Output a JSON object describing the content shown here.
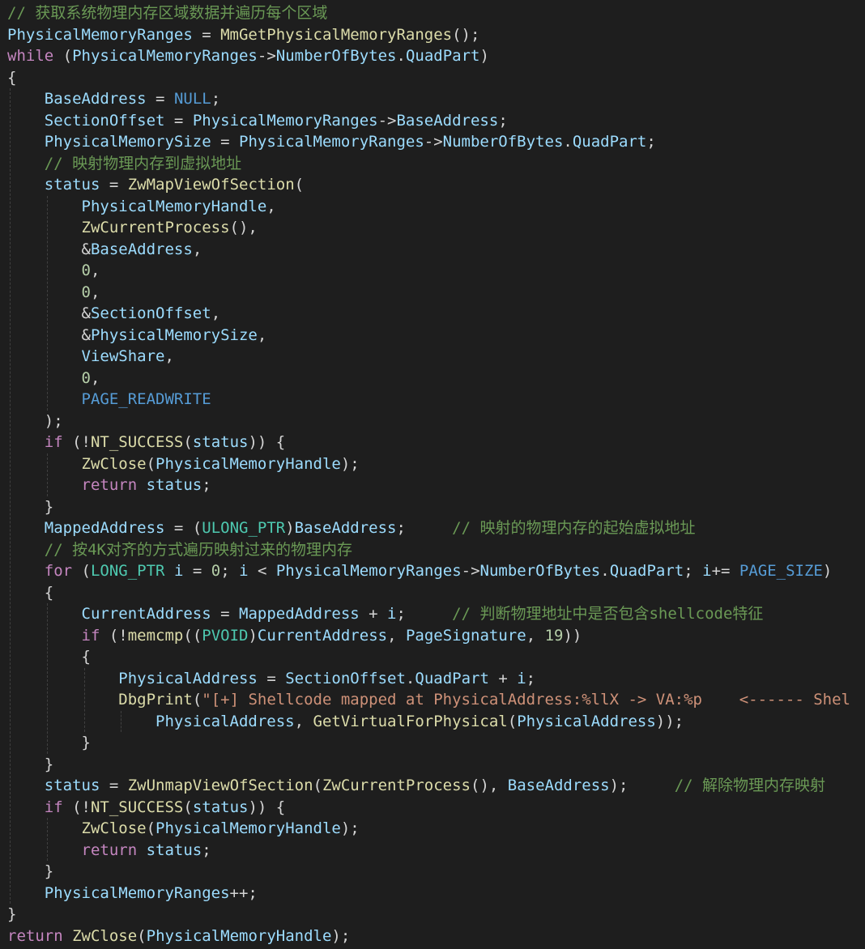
{
  "editor": {
    "theme": {
      "background": "#1e1e1e",
      "comment": "#6a9955",
      "variable": "#9cdcfe",
      "function": "#dcdcaa",
      "control_keyword": "#c586c0",
      "keyword": "#569cd6",
      "type": "#4ec9b0",
      "number": "#b5cea8",
      "string": "#ce9178",
      "punctuation": "#d4d4d4"
    },
    "lines": [
      {
        "indent": 0,
        "tokens": [
          {
            "t": "// 获取系统物理内存区域数据并遍历每个区域",
            "c": "c"
          }
        ]
      },
      {
        "indent": 0,
        "tokens": [
          {
            "t": "PhysicalMemoryRanges",
            "c": "v"
          },
          {
            "t": " = ",
            "c": "p"
          },
          {
            "t": "MmGetPhysicalMemoryRanges",
            "c": "f"
          },
          {
            "t": "();",
            "c": "p"
          }
        ]
      },
      {
        "indent": 0,
        "tokens": [
          {
            "t": "while",
            "c": "k"
          },
          {
            "t": " (",
            "c": "p"
          },
          {
            "t": "PhysicalMemoryRanges",
            "c": "v"
          },
          {
            "t": "->",
            "c": "p"
          },
          {
            "t": "NumberOfBytes",
            "c": "v"
          },
          {
            "t": ".",
            "c": "p"
          },
          {
            "t": "QuadPart",
            "c": "v"
          },
          {
            "t": ")",
            "c": "p"
          }
        ]
      },
      {
        "indent": 0,
        "tokens": [
          {
            "t": "{",
            "c": "p"
          }
        ]
      },
      {
        "indent": 1,
        "tokens": [
          {
            "t": "BaseAddress",
            "c": "v"
          },
          {
            "t": " = ",
            "c": "p"
          },
          {
            "t": "NULL",
            "c": "kb"
          },
          {
            "t": ";",
            "c": "p"
          }
        ]
      },
      {
        "indent": 1,
        "tokens": [
          {
            "t": "SectionOffset",
            "c": "v"
          },
          {
            "t": " = ",
            "c": "p"
          },
          {
            "t": "PhysicalMemoryRanges",
            "c": "v"
          },
          {
            "t": "->",
            "c": "p"
          },
          {
            "t": "BaseAddress",
            "c": "v"
          },
          {
            "t": ";",
            "c": "p"
          }
        ]
      },
      {
        "indent": 1,
        "tokens": [
          {
            "t": "PhysicalMemorySize",
            "c": "v"
          },
          {
            "t": " = ",
            "c": "p"
          },
          {
            "t": "PhysicalMemoryRanges",
            "c": "v"
          },
          {
            "t": "->",
            "c": "p"
          },
          {
            "t": "NumberOfBytes",
            "c": "v"
          },
          {
            "t": ".",
            "c": "p"
          },
          {
            "t": "QuadPart",
            "c": "v"
          },
          {
            "t": ";",
            "c": "p"
          }
        ]
      },
      {
        "indent": 1,
        "tokens": [
          {
            "t": "// 映射物理内存到虚拟地址",
            "c": "c"
          }
        ]
      },
      {
        "indent": 1,
        "tokens": [
          {
            "t": "status",
            "c": "v"
          },
          {
            "t": " = ",
            "c": "p"
          },
          {
            "t": "ZwMapViewOfSection",
            "c": "f"
          },
          {
            "t": "(",
            "c": "p"
          }
        ]
      },
      {
        "indent": 2,
        "tokens": [
          {
            "t": "PhysicalMemoryHandle",
            "c": "v"
          },
          {
            "t": ",",
            "c": "p"
          }
        ]
      },
      {
        "indent": 2,
        "tokens": [
          {
            "t": "ZwCurrentProcess",
            "c": "f"
          },
          {
            "t": "(),",
            "c": "p"
          }
        ]
      },
      {
        "indent": 2,
        "tokens": [
          {
            "t": "&",
            "c": "p"
          },
          {
            "t": "BaseAddress",
            "c": "v"
          },
          {
            "t": ",",
            "c": "p"
          }
        ]
      },
      {
        "indent": 2,
        "tokens": [
          {
            "t": "0",
            "c": "n"
          },
          {
            "t": ",",
            "c": "p"
          }
        ]
      },
      {
        "indent": 2,
        "tokens": [
          {
            "t": "0",
            "c": "n"
          },
          {
            "t": ",",
            "c": "p"
          }
        ]
      },
      {
        "indent": 2,
        "tokens": [
          {
            "t": "&",
            "c": "p"
          },
          {
            "t": "SectionOffset",
            "c": "v"
          },
          {
            "t": ",",
            "c": "p"
          }
        ]
      },
      {
        "indent": 2,
        "tokens": [
          {
            "t": "&",
            "c": "p"
          },
          {
            "t": "PhysicalMemorySize",
            "c": "v"
          },
          {
            "t": ",",
            "c": "p"
          }
        ]
      },
      {
        "indent": 2,
        "tokens": [
          {
            "t": "ViewShare",
            "c": "v"
          },
          {
            "t": ",",
            "c": "p"
          }
        ]
      },
      {
        "indent": 2,
        "tokens": [
          {
            "t": "0",
            "c": "n"
          },
          {
            "t": ",",
            "c": "p"
          }
        ]
      },
      {
        "indent": 2,
        "tokens": [
          {
            "t": "PAGE_READWRITE",
            "c": "kb"
          }
        ]
      },
      {
        "indent": 1,
        "tokens": [
          {
            "t": ");",
            "c": "p"
          }
        ]
      },
      {
        "indent": 1,
        "tokens": [
          {
            "t": "if",
            "c": "k"
          },
          {
            "t": " (!",
            "c": "p"
          },
          {
            "t": "NT_SUCCESS",
            "c": "f"
          },
          {
            "t": "(",
            "c": "p"
          },
          {
            "t": "status",
            "c": "v"
          },
          {
            "t": ")) {",
            "c": "p"
          }
        ]
      },
      {
        "indent": 2,
        "tokens": [
          {
            "t": "ZwClose",
            "c": "f"
          },
          {
            "t": "(",
            "c": "p"
          },
          {
            "t": "PhysicalMemoryHandle",
            "c": "v"
          },
          {
            "t": ");",
            "c": "p"
          }
        ]
      },
      {
        "indent": 2,
        "tokens": [
          {
            "t": "return",
            "c": "k"
          },
          {
            "t": " ",
            "c": "p"
          },
          {
            "t": "status",
            "c": "v"
          },
          {
            "t": ";",
            "c": "p"
          }
        ]
      },
      {
        "indent": 1,
        "tokens": [
          {
            "t": "}",
            "c": "p"
          }
        ]
      },
      {
        "indent": 1,
        "tokens": [
          {
            "t": "MappedAddress",
            "c": "v"
          },
          {
            "t": " = (",
            "c": "p"
          },
          {
            "t": "ULONG_PTR",
            "c": "t"
          },
          {
            "t": ")",
            "c": "p"
          },
          {
            "t": "BaseAddress",
            "c": "v"
          },
          {
            "t": ";     ",
            "c": "p"
          },
          {
            "t": "// 映射的物理内存的起始虚拟地址",
            "c": "c"
          }
        ]
      },
      {
        "indent": 1,
        "tokens": [
          {
            "t": "// 按4K对齐的方式遍历映射过来的物理内存",
            "c": "c"
          }
        ]
      },
      {
        "indent": 1,
        "tokens": [
          {
            "t": "for",
            "c": "k"
          },
          {
            "t": " (",
            "c": "p"
          },
          {
            "t": "LONG_PTR",
            "c": "t"
          },
          {
            "t": " ",
            "c": "p"
          },
          {
            "t": "i",
            "c": "v"
          },
          {
            "t": " = ",
            "c": "p"
          },
          {
            "t": "0",
            "c": "n"
          },
          {
            "t": "; ",
            "c": "p"
          },
          {
            "t": "i",
            "c": "v"
          },
          {
            "t": " < ",
            "c": "p"
          },
          {
            "t": "PhysicalMemoryRanges",
            "c": "v"
          },
          {
            "t": "->",
            "c": "p"
          },
          {
            "t": "NumberOfBytes",
            "c": "v"
          },
          {
            "t": ".",
            "c": "p"
          },
          {
            "t": "QuadPart",
            "c": "v"
          },
          {
            "t": "; ",
            "c": "p"
          },
          {
            "t": "i",
            "c": "v"
          },
          {
            "t": "+= ",
            "c": "p"
          },
          {
            "t": "PAGE_SIZE",
            "c": "kb"
          },
          {
            "t": ")",
            "c": "p"
          }
        ]
      },
      {
        "indent": 1,
        "tokens": [
          {
            "t": "{",
            "c": "p"
          }
        ]
      },
      {
        "indent": 2,
        "tokens": [
          {
            "t": "CurrentAddress",
            "c": "v"
          },
          {
            "t": " = ",
            "c": "p"
          },
          {
            "t": "MappedAddress",
            "c": "v"
          },
          {
            "t": " + ",
            "c": "p"
          },
          {
            "t": "i",
            "c": "v"
          },
          {
            "t": ";     ",
            "c": "p"
          },
          {
            "t": "// 判断物理地址中是否包含shellcode特征",
            "c": "c"
          }
        ]
      },
      {
        "indent": 2,
        "tokens": [
          {
            "t": "if",
            "c": "k"
          },
          {
            "t": " (!",
            "c": "p"
          },
          {
            "t": "memcmp",
            "c": "f"
          },
          {
            "t": "((",
            "c": "p"
          },
          {
            "t": "PVOID",
            "c": "t"
          },
          {
            "t": ")",
            "c": "p"
          },
          {
            "t": "CurrentAddress",
            "c": "v"
          },
          {
            "t": ", ",
            "c": "p"
          },
          {
            "t": "PageSignature",
            "c": "v"
          },
          {
            "t": ", ",
            "c": "p"
          },
          {
            "t": "19",
            "c": "n"
          },
          {
            "t": "))",
            "c": "p"
          }
        ]
      },
      {
        "indent": 2,
        "tokens": [
          {
            "t": "{",
            "c": "p"
          }
        ]
      },
      {
        "indent": 3,
        "tokens": [
          {
            "t": "PhysicalAddress",
            "c": "v"
          },
          {
            "t": " = ",
            "c": "p"
          },
          {
            "t": "SectionOffset",
            "c": "v"
          },
          {
            "t": ".",
            "c": "p"
          },
          {
            "t": "QuadPart",
            "c": "v"
          },
          {
            "t": " + ",
            "c": "p"
          },
          {
            "t": "i",
            "c": "v"
          },
          {
            "t": ";",
            "c": "p"
          }
        ]
      },
      {
        "indent": 3,
        "tokens": [
          {
            "t": "DbgPrint",
            "c": "f"
          },
          {
            "t": "(",
            "c": "p"
          },
          {
            "t": "\"[+] Shellcode mapped at PhysicalAddress:%llX -> VA:%p    <------ Shel",
            "c": "s"
          }
        ]
      },
      {
        "indent": 4,
        "tokens": [
          {
            "t": "PhysicalAddress",
            "c": "v"
          },
          {
            "t": ", ",
            "c": "p"
          },
          {
            "t": "GetVirtualForPhysical",
            "c": "f"
          },
          {
            "t": "(",
            "c": "p"
          },
          {
            "t": "PhysicalAddress",
            "c": "v"
          },
          {
            "t": "));",
            "c": "p"
          }
        ]
      },
      {
        "indent": 2,
        "tokens": [
          {
            "t": "}",
            "c": "p"
          }
        ]
      },
      {
        "indent": 1,
        "tokens": [
          {
            "t": "}",
            "c": "p"
          }
        ]
      },
      {
        "indent": 1,
        "tokens": [
          {
            "t": "status",
            "c": "v"
          },
          {
            "t": " = ",
            "c": "p"
          },
          {
            "t": "ZwUnmapViewOfSection",
            "c": "f"
          },
          {
            "t": "(",
            "c": "p"
          },
          {
            "t": "ZwCurrentProcess",
            "c": "f"
          },
          {
            "t": "(), ",
            "c": "p"
          },
          {
            "t": "BaseAddress",
            "c": "v"
          },
          {
            "t": ");     ",
            "c": "p"
          },
          {
            "t": "// 解除物理内存映射",
            "c": "c"
          }
        ]
      },
      {
        "indent": 1,
        "tokens": [
          {
            "t": "if",
            "c": "k"
          },
          {
            "t": " (!",
            "c": "p"
          },
          {
            "t": "NT_SUCCESS",
            "c": "f"
          },
          {
            "t": "(",
            "c": "p"
          },
          {
            "t": "status",
            "c": "v"
          },
          {
            "t": ")) {",
            "c": "p"
          }
        ]
      },
      {
        "indent": 2,
        "tokens": [
          {
            "t": "ZwClose",
            "c": "f"
          },
          {
            "t": "(",
            "c": "p"
          },
          {
            "t": "PhysicalMemoryHandle",
            "c": "v"
          },
          {
            "t": ");",
            "c": "p"
          }
        ]
      },
      {
        "indent": 2,
        "tokens": [
          {
            "t": "return",
            "c": "k"
          },
          {
            "t": " ",
            "c": "p"
          },
          {
            "t": "status",
            "c": "v"
          },
          {
            "t": ";",
            "c": "p"
          }
        ]
      },
      {
        "indent": 1,
        "tokens": [
          {
            "t": "}",
            "c": "p"
          }
        ]
      },
      {
        "indent": 1,
        "tokens": [
          {
            "t": "PhysicalMemoryRanges",
            "c": "v"
          },
          {
            "t": "++;",
            "c": "p"
          }
        ]
      },
      {
        "indent": 0,
        "tokens": [
          {
            "t": "}",
            "c": "p"
          }
        ]
      },
      {
        "indent": 0,
        "tokens": [
          {
            "t": "return",
            "c": "k"
          },
          {
            "t": " ",
            "c": "p"
          },
          {
            "t": "ZwClose",
            "c": "f"
          },
          {
            "t": "(",
            "c": "p"
          },
          {
            "t": "PhysicalMemoryHandle",
            "c": "v"
          },
          {
            "t": ");",
            "c": "p"
          }
        ]
      }
    ]
  }
}
